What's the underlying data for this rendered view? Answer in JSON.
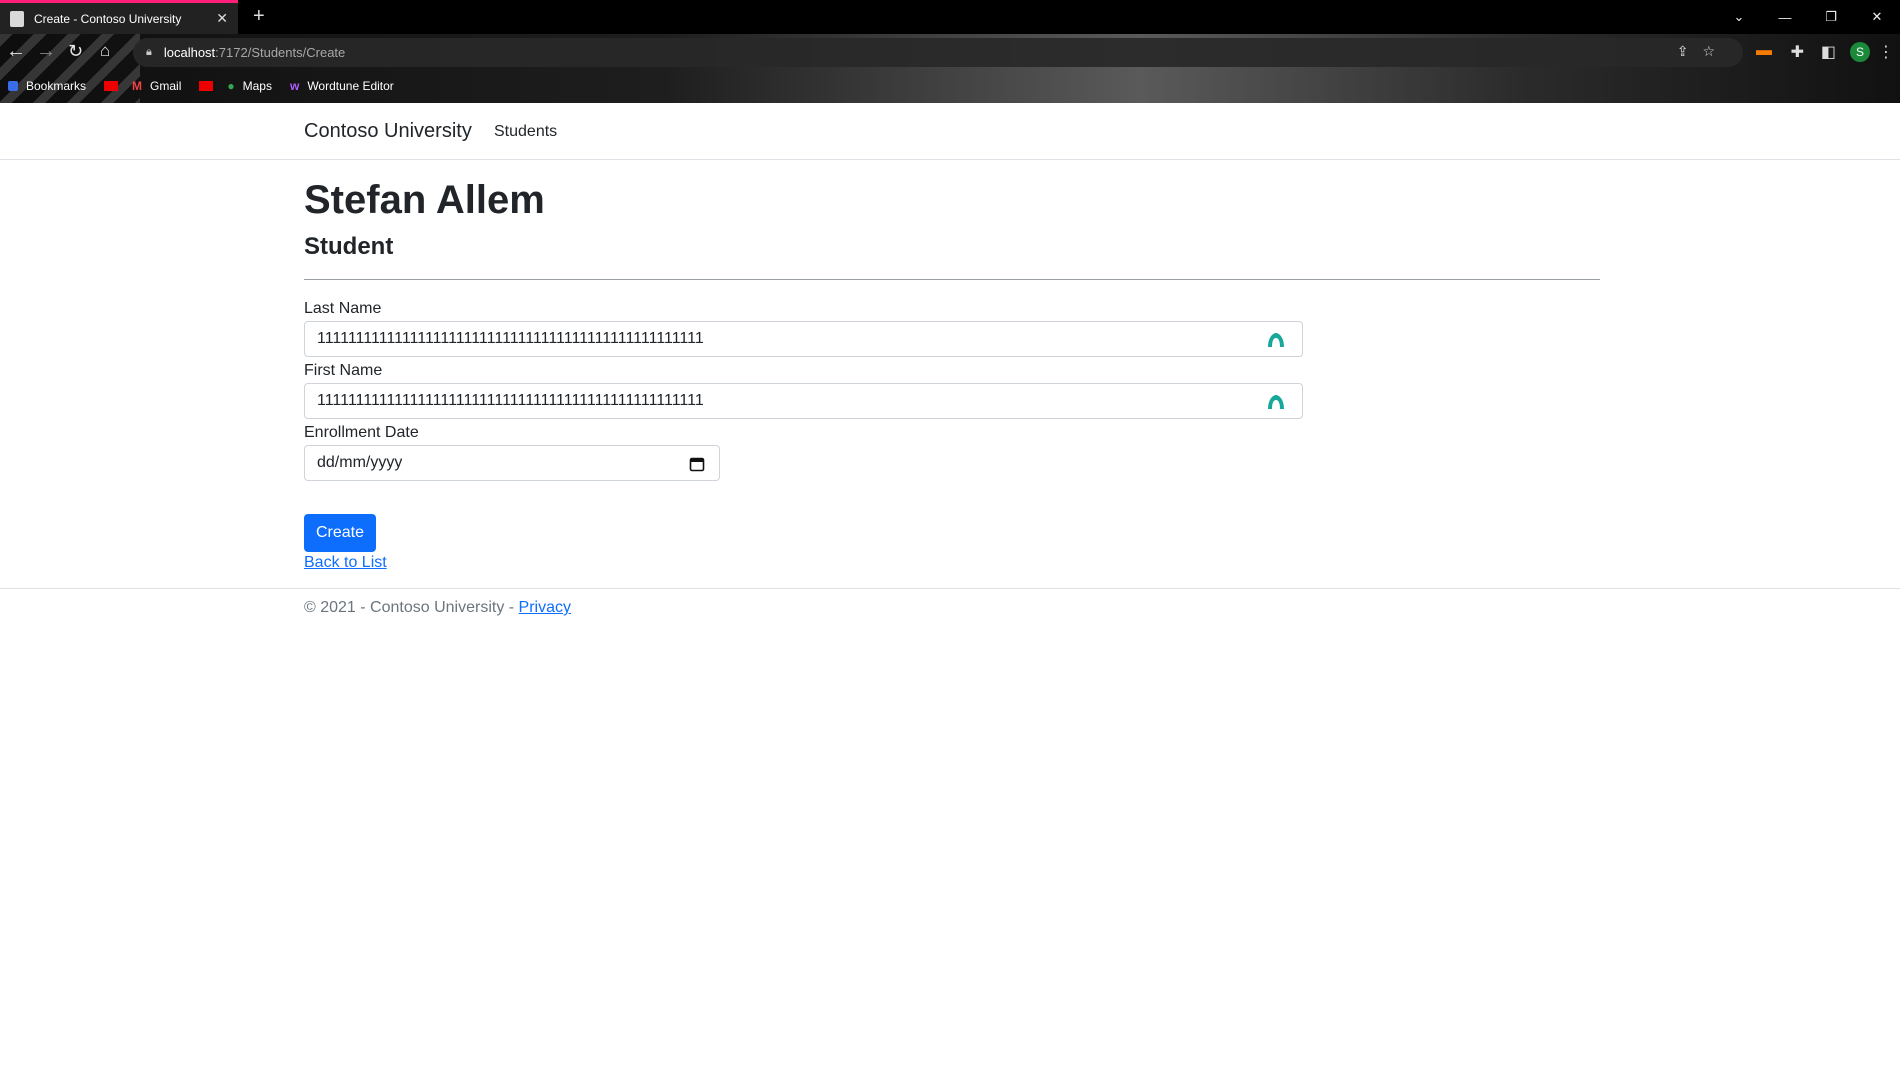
{
  "browser": {
    "tab_title": "Create - Contoso University",
    "url_host": "localhost",
    "url_path": ":7172/Students/Create",
    "bookmarks": [
      "Bookmarks",
      "Gmail",
      "Maps",
      "Wordtune Editor"
    ],
    "profile_initial": "S"
  },
  "site": {
    "brand": "Contoso University",
    "nav_students": "Students"
  },
  "page": {
    "heading": "Stefan Allem",
    "subheading": "Student"
  },
  "form": {
    "last_name_label": "Last Name",
    "last_name_value": "11111111111111111111111111111111111111111111111111",
    "first_name_label": "First Name",
    "first_name_value": "11111111111111111111111111111111111111111111111111",
    "enrollment_label": "Enrollment Date",
    "enrollment_placeholder": "dd/mm/yyyy",
    "create_button": "Create",
    "back_link": "Back to List"
  },
  "footer": {
    "text": "© 2021 - Contoso University - ",
    "privacy": "Privacy"
  },
  "colors": {
    "primary": "#0d6efd",
    "tab_accent": "#ff1f7a",
    "wordtune_icon": "#17a89a"
  }
}
